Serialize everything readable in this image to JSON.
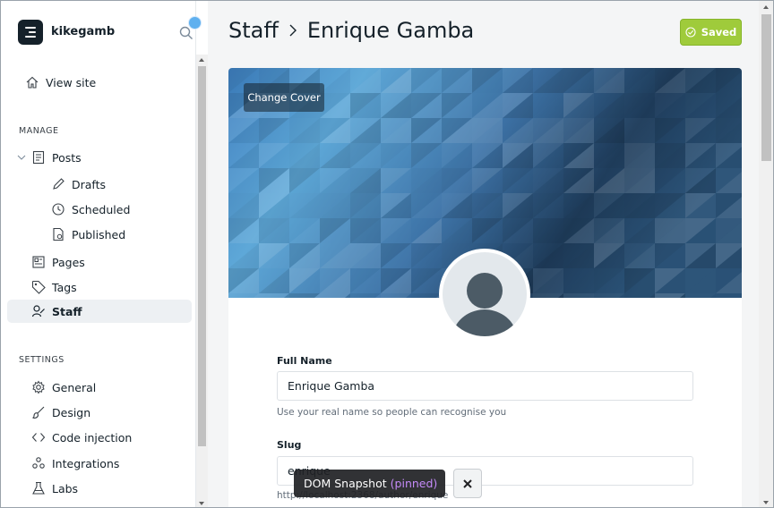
{
  "sidebar": {
    "blog_name": "kikegamb",
    "view_site": "View site",
    "manage_label": "MANAGE",
    "posts": "Posts",
    "drafts": "Drafts",
    "scheduled": "Scheduled",
    "published": "Published",
    "pages": "Pages",
    "tags": "Tags",
    "staff": "Staff",
    "settings_label": "SETTINGS",
    "general": "General",
    "design": "Design",
    "code_injection": "Code injection",
    "integrations": "Integrations",
    "labs": "Labs"
  },
  "header": {
    "crumb_parent": "Staff",
    "crumb_current": "Enrique Gamba",
    "saved_label": "Saved"
  },
  "profile": {
    "change_cover": "Change Cover",
    "full_name_label": "Full Name",
    "full_name_value": "Enrique Gamba",
    "full_name_hint": "Use your real name so people can recognise you",
    "slug_label": "Slug",
    "slug_value": "enrique",
    "slug_hint": "http://localhost:2368/author/enrique"
  },
  "devtools": {
    "snapshot_label": "DOM Snapshot",
    "snapshot_state": "(pinned)"
  },
  "colors": {
    "saved_green": "#9fcb3b",
    "accent_dot": "#5fb0ef",
    "active_bg": "#edf0f3"
  }
}
